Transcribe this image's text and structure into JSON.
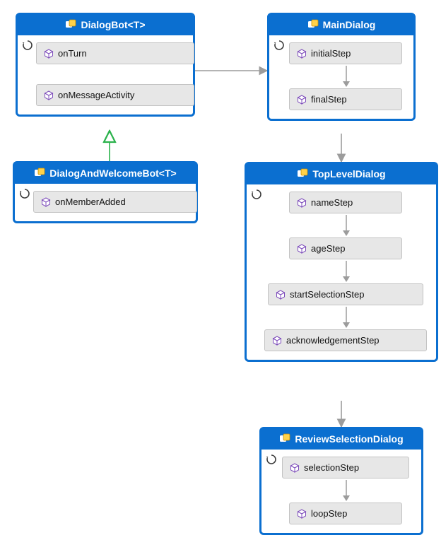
{
  "classes": {
    "dialogBot": {
      "title": "DialogBot<T>",
      "methods": [
        "onTurn",
        "onMessageActivity"
      ]
    },
    "dialogAndWelcomeBot": {
      "title": "DialogAndWelcomeBot<T>",
      "methods": [
        "onMemberAdded"
      ]
    },
    "mainDialog": {
      "title": "MainDialog",
      "methods": [
        "initialStep",
        "finalStep"
      ]
    },
    "topLevelDialog": {
      "title": "TopLevelDialog",
      "methods": [
        "nameStep",
        "ageStep",
        "startSelectionStep",
        "acknowledgementStep"
      ]
    },
    "reviewSelectionDialog": {
      "title": "ReviewSelectionDialog",
      "methods": [
        "selectionStep",
        "loopStep"
      ]
    }
  },
  "colors": {
    "primary": "#0b6fd0",
    "methodBg": "#e7e7e7",
    "methodBorder": "#c3c3c3",
    "connector": "#9c9c9c",
    "inherit": "#2bb24c",
    "cubePurple": "#7d4cbb"
  }
}
